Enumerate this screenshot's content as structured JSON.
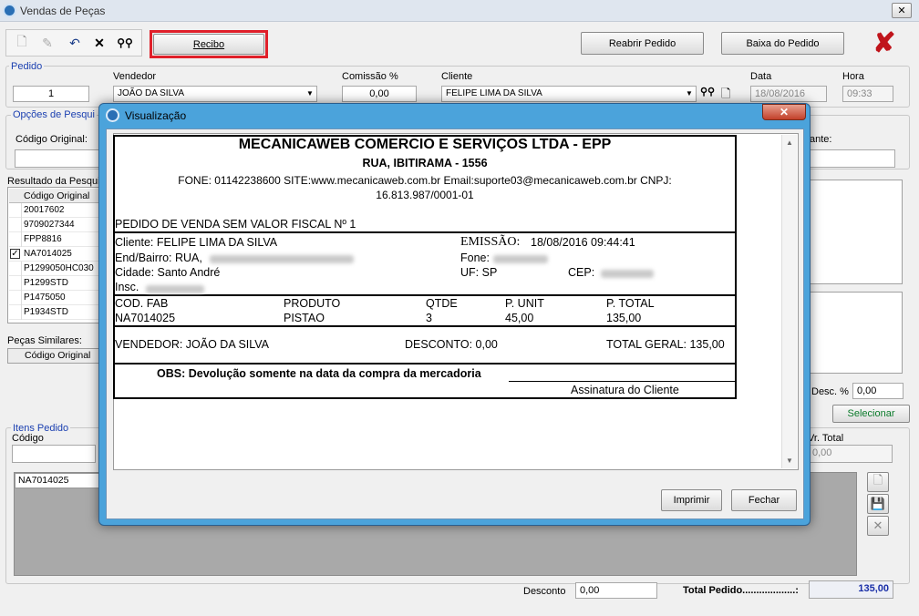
{
  "window": {
    "title": "Vendas de Peças"
  },
  "toolbar": {
    "recibo": "Recibo",
    "reabrir": "Reabrir Pedido",
    "baixa": "Baixa do Pedido"
  },
  "pedido": {
    "group": "Pedido",
    "numero": "1",
    "vendedor_label": "Vendedor",
    "vendedor": "JOÃO DA SILVA",
    "comissao_label": "Comissão %",
    "comissao": "0,00",
    "cliente_label": "Cliente",
    "cliente": "FELIPE LIMA DA SILVA",
    "data_label": "Data",
    "data": "18/08/2016",
    "hora_label": "Hora",
    "hora": "09:33"
  },
  "opcoes": {
    "group": "Opções de Pesqui",
    "codigo_original": "Código Original:",
    "right_label": "ante:"
  },
  "resultado": {
    "label": "Resultado da Pesqui",
    "col": "Código Original",
    "rows": [
      "20017602",
      "9709027344",
      "FPP8816",
      "NA7014025",
      "P1299050HC030",
      "P1299STD",
      "P1475050",
      "P1934STD"
    ]
  },
  "similares": {
    "label": "Peças Similares:",
    "col": "Código Original"
  },
  "desc": {
    "label": "Desc. %",
    "value": "0,00",
    "selecionar": "Selecionar"
  },
  "itens": {
    "group": "Itens Pedido",
    "codigo": "Código",
    "vr_total": "Vr. Total",
    "vr_total_value": "0,00",
    "item_row": "NA7014025"
  },
  "footer": {
    "desconto_label": "Desconto",
    "desconto": "0,00",
    "total_label": "Total Pedido...................:",
    "total": "135,00"
  },
  "dialog": {
    "title": "Visualização",
    "imprimir": "Imprimir",
    "fechar": "Fechar",
    "receipt": {
      "company": "MECANICAWEB COMERCIO E SERVIÇOS LTDA - EPP",
      "address": "RUA, IBITIRAMA - 1556",
      "contact1": "FONE: 01142238600 SITE:www.mecanicaweb.com.br Email:suporte03@mecanicaweb.com.br CNPJ:",
      "contact2": "16.813.987/0001-01",
      "order_title": "PEDIDO DE VENDA SEM VALOR FISCAL Nº 1",
      "cliente": "Cliente: FELIPE LIMA DA SILVA",
      "emissao_label": "EMISSÃO:",
      "emissao": "18/08/2016 09:44:41",
      "end": "End/Bairro: RUA,",
      "fone": "Fone:",
      "cidade": "Cidade: Santo André",
      "uf": "UF: SP",
      "cep": "CEP:",
      "insc": "Insc.",
      "headers": [
        "COD. FAB",
        "PRODUTO",
        "QTDE",
        "P. UNIT",
        "P. TOTAL"
      ],
      "item": [
        "NA7014025",
        "PISTAO",
        "3",
        "45,00",
        "135,00"
      ],
      "vendedor": "VENDEDOR: JOÃO DA SILVA",
      "desconto": "DESCONTO: 0,00",
      "total_geral": "TOTAL GERAL: 135,00",
      "obs": "OBS: Devolução somente na data da compra da mercadoria",
      "assinatura": "Assinatura do Cliente"
    }
  }
}
